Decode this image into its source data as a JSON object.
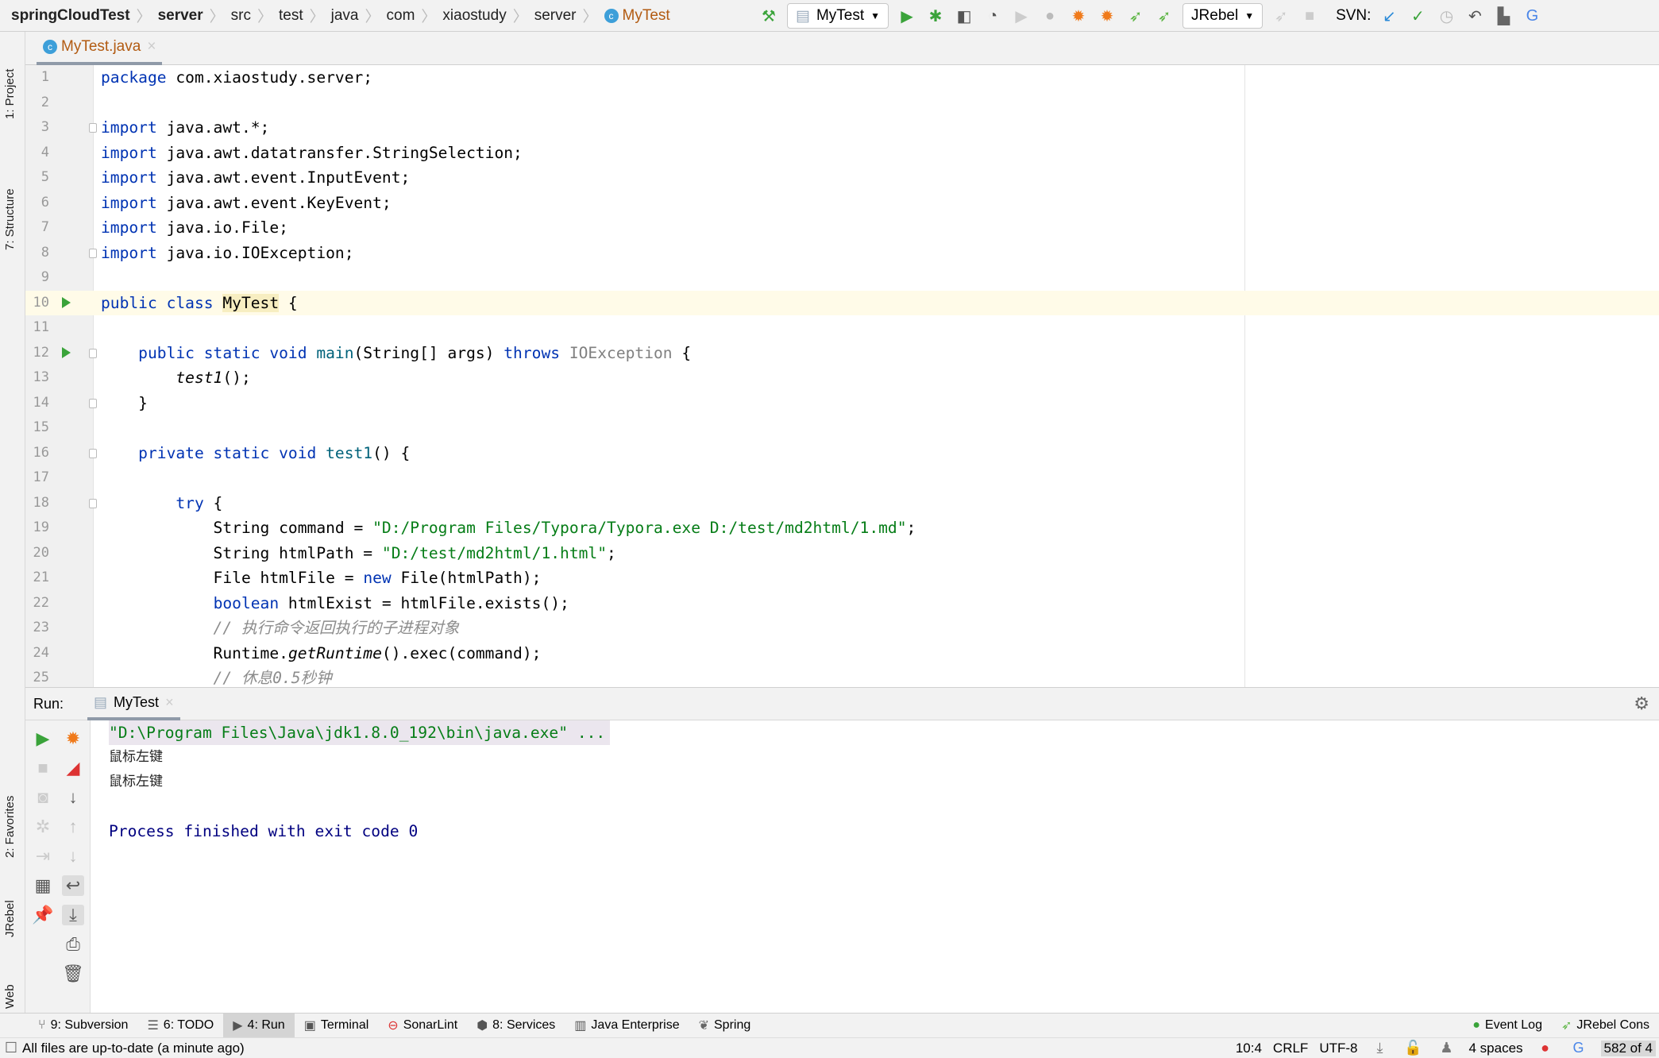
{
  "breadcrumb": [
    "springCloudTest",
    "server",
    "src",
    "test",
    "java",
    "com",
    "xiaostudy",
    "server",
    "MyTest"
  ],
  "toolbar": {
    "run_config": "MyTest",
    "jrebel": "JRebel",
    "svn_label": "SVN:"
  },
  "editor_tab": {
    "label": "MyTest.java"
  },
  "left_stripe": {
    "project": "1: Project",
    "structure": "7: Structure",
    "favorites": "2: Favorites",
    "jrebel": "JRebel",
    "web": "Web"
  },
  "code": [
    {
      "n": "1",
      "t": [
        [
          "package",
          "kw"
        ],
        [
          " com.xiaostudy.server;",
          ""
        ]
      ]
    },
    {
      "n": "2",
      "t": []
    },
    {
      "n": "3",
      "fold": true,
      "t": [
        [
          "import",
          "kw"
        ],
        [
          " java.awt.*;",
          ""
        ]
      ]
    },
    {
      "n": "4",
      "t": [
        [
          "import",
          "kw"
        ],
        [
          " java.awt.datatransfer.StringSelection;",
          ""
        ]
      ]
    },
    {
      "n": "5",
      "t": [
        [
          "import",
          "kw"
        ],
        [
          " java.awt.event.InputEvent;",
          ""
        ]
      ]
    },
    {
      "n": "6",
      "t": [
        [
          "import",
          "kw"
        ],
        [
          " java.awt.event.KeyEvent;",
          ""
        ]
      ]
    },
    {
      "n": "7",
      "t": [
        [
          "import",
          "kw"
        ],
        [
          " java.io.File;",
          ""
        ]
      ]
    },
    {
      "n": "8",
      "fold": true,
      "t": [
        [
          "import",
          "kw"
        ],
        [
          " java.io.IOException;",
          ""
        ]
      ]
    },
    {
      "n": "9",
      "t": []
    },
    {
      "n": "10",
      "run": true,
      "current": true,
      "t": [
        [
          "public class ",
          "kw"
        ],
        [
          "MyTest",
          "hl"
        ],
        [
          " {",
          ""
        ]
      ]
    },
    {
      "n": "11",
      "t": []
    },
    {
      "n": "12",
      "run": true,
      "fold": true,
      "t": [
        [
          "    public static void ",
          "kw"
        ],
        [
          "main",
          "fn"
        ],
        [
          "(String[] args) ",
          ""
        ],
        [
          "throws ",
          "kw"
        ],
        [
          "IOException",
          "gr"
        ],
        [
          " {",
          ""
        ]
      ]
    },
    {
      "n": "13",
      "t": [
        [
          "        ",
          ""
        ],
        [
          "test1",
          "it"
        ],
        [
          "();",
          ""
        ]
      ]
    },
    {
      "n": "14",
      "fold": true,
      "t": [
        [
          "    }",
          ""
        ]
      ]
    },
    {
      "n": "15",
      "t": []
    },
    {
      "n": "16",
      "fold": true,
      "t": [
        [
          "    private static void ",
          "kw"
        ],
        [
          "test1",
          "fn"
        ],
        [
          "() {",
          ""
        ]
      ]
    },
    {
      "n": "17",
      "t": []
    },
    {
      "n": "18",
      "fold": true,
      "t": [
        [
          "        try",
          "kw"
        ],
        [
          " {",
          ""
        ]
      ]
    },
    {
      "n": "19",
      "t": [
        [
          "            String command = ",
          ""
        ],
        [
          "\"D:/Program Files/Typora/Typora.exe D:/test/md2html/1.md\"",
          "str"
        ],
        [
          ";",
          ""
        ]
      ]
    },
    {
      "n": "20",
      "t": [
        [
          "            String htmlPath = ",
          ""
        ],
        [
          "\"D:/test/md2html/1.html\"",
          "str"
        ],
        [
          ";",
          ""
        ]
      ]
    },
    {
      "n": "21",
      "t": [
        [
          "            File htmlFile = ",
          ""
        ],
        [
          "new",
          "kw"
        ],
        [
          " File(htmlPath);",
          ""
        ]
      ]
    },
    {
      "n": "22",
      "t": [
        [
          "            ",
          ""
        ],
        [
          "boolean",
          "kw"
        ],
        [
          " htmlExist = htmlFile.exists();",
          ""
        ]
      ]
    },
    {
      "n": "23",
      "t": [
        [
          "            // 执行命令返回执行的子进程对象",
          "cm"
        ]
      ]
    },
    {
      "n": "24",
      "t": [
        [
          "            Runtime.",
          ""
        ],
        [
          "getRuntime",
          "it"
        ],
        [
          "().exec(command);",
          ""
        ]
      ]
    },
    {
      "n": "25",
      "t": [
        [
          "            // 休息0.5秒钟",
          "cm"
        ]
      ]
    }
  ],
  "run_panel": {
    "label": "Run:",
    "tab": "MyTest",
    "console": [
      "\"D:\\Program Files\\Java\\jdk1.8.0_192\\bin\\java.exe\" ...",
      "鼠标左键",
      "鼠标左键",
      "",
      "Process finished with exit code 0"
    ]
  },
  "tool_windows": [
    {
      "label": "9: Subversion",
      "icon": "subversion-icon"
    },
    {
      "label": "6: TODO",
      "icon": "todo-icon"
    },
    {
      "label": "4: Run",
      "icon": "run-icon",
      "active": true
    },
    {
      "label": "Terminal",
      "icon": "terminal-icon"
    },
    {
      "label": "SonarLint",
      "icon": "sonarlint-icon"
    },
    {
      "label": "8: Services",
      "icon": "services-icon"
    },
    {
      "label": "Java Enterprise",
      "icon": "java-enterprise-icon"
    },
    {
      "label": "Spring",
      "icon": "spring-icon"
    }
  ],
  "tool_windows_right": [
    {
      "label": "Event Log"
    },
    {
      "label": "JRebel Cons"
    }
  ],
  "status": {
    "message": "All files are up-to-date (a minute ago)",
    "position": "10:4",
    "line_sep": "CRLF",
    "encoding": "UTF-8",
    "indent": "4 spaces",
    "memory": "582 of 4"
  },
  "colors": {
    "keyword": "#0033b3",
    "string": "#067d17",
    "comment": "#8c8c8c",
    "run_green": "#3aa33a",
    "file_name": "#b25b12"
  }
}
